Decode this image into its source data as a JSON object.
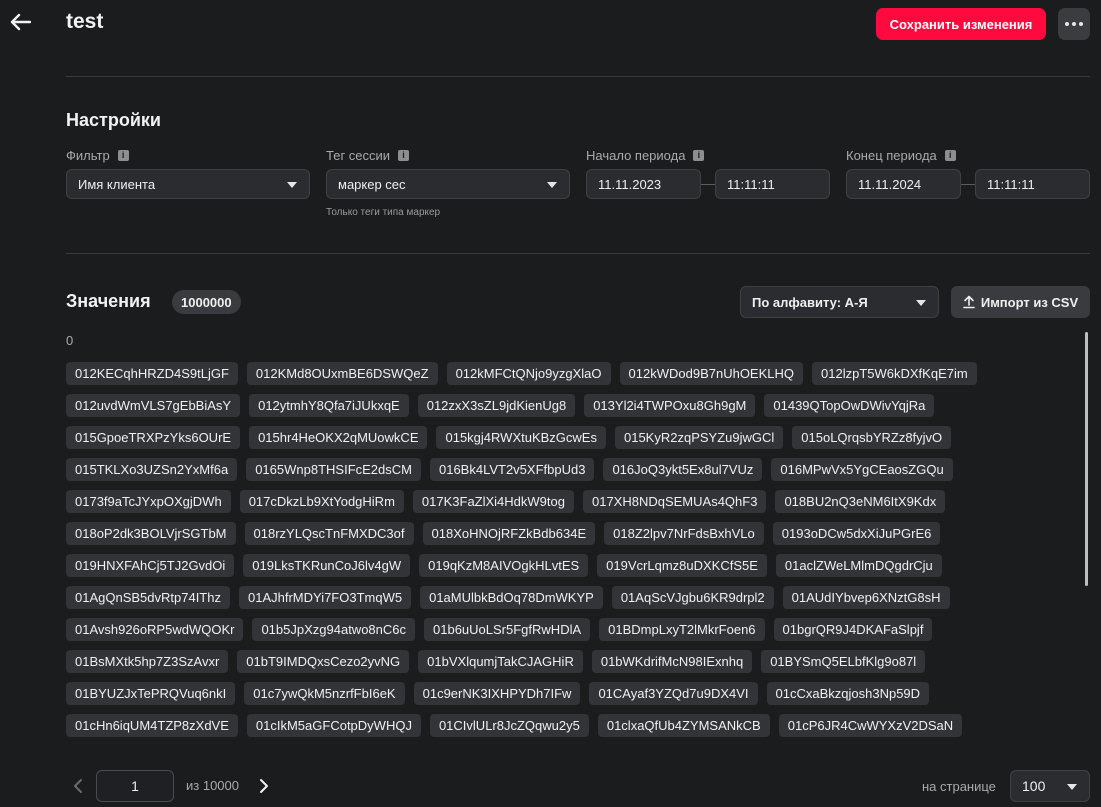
{
  "header": {
    "title": "test",
    "save_label": "Сохранить изменения"
  },
  "settings": {
    "title": "Настройки",
    "filter": {
      "label": "Фильтр",
      "value": "Имя клиента"
    },
    "session_tag": {
      "label": "Тег сессии",
      "value": "маркер сес",
      "helper": "Только теги типа маркер"
    },
    "period_start": {
      "label": "Начало периода",
      "date": "11.11.2023",
      "time": "11:11:11"
    },
    "period_end": {
      "label": "Конец периода",
      "date": "11.11.2024",
      "time": "11:11:11"
    }
  },
  "values": {
    "title": "Значения",
    "count": "1000000",
    "sort_value": "По алфавиту: А-Я",
    "import_label": "Импорт из CSV",
    "empty_value": "0",
    "items": [
      "012KECqhHRZD4S9tLjGF",
      "012KMd8OUxmBE6DSWQeZ",
      "012kMFCtQNjo9yzgXlaO",
      "012kWDod9B7nUhOEKLHQ",
      "012lzpT5W6kDXfKqE7im",
      "012uvdWmVLS7gEbBiAsY",
      "012ytmhY8Qfa7iJUkxqE",
      "012zxX3sZL9jdKienUg8",
      "013Yl2i4TWPOxu8Gh9gM",
      "01439QTopOwDWivYqjRa",
      "015GpoeTRXPzYks6OUrE",
      "015hr4HeOKX2qMUowkCE",
      "015kgj4RWXtuKBzGcwEs",
      "015KyR2zqPSYZu9jwGCl",
      "015oLQrqsbYRZz8fyjvO",
      "015TKLXo3UZSn2YxMf6a",
      "0165Wnp8THSIFcE2dsCM",
      "016Bk4LVT2v5XFfbpUd3",
      "016JoQ3ykt5Ex8ul7VUz",
      "016MPwVx5YgCEaosZGQu",
      "0173f9aTcJYxpOXgjDWh",
      "017cDkzLb9XtYodgHiRm",
      "017K3FaZlXi4HdkW9tog",
      "017XH8NDqSEMUAs4QhF3",
      "018BU2nQ3eNM6ItX9Kdx",
      "018oP2dk3BOLVjrSGTbM",
      "018rzYLQscTnFMXDC3of",
      "018XoHNOjRFZkBdb634E",
      "018Z2lpv7NrFdsBxhVLo",
      "0193oDCw5dxXiJuPGrE6",
      "019HNXFAhCj5TJ2GvdOi",
      "019LksTKRunCoJ6lv4gW",
      "019qKzM8AIVOgkHLvtES",
      "019VcrLqmz8uDXKCfS5E",
      "01aclZWeLMlmDQgdrCju",
      "01AgQnSB5dvRtp74IThz",
      "01AJhfrMDYi7FO3TmqW5",
      "01aMUlbkBdOq78DmWKYP",
      "01AqScVJgbu6KR9drpl2",
      "01AUdIYbvep6XNztG8sH",
      "01Avsh926oRP5wdWQOKr",
      "01b5JpXzg94atwo8nC6c",
      "01b6uUoLSr5FgfRwHDlA",
      "01BDmpLxyT2lMkrFoen6",
      "01bgrQR9J4DKAFaSlpjf",
      "01BsMXtk5hp7Z3SzAvxr",
      "01bT9IMDQxsCezo2yvNG",
      "01bVXlqumjTakCJAGHiR",
      "01bWKdrifMcN98IExnhq",
      "01BYSmQ5ELbfKlg9o87l",
      "01BYUZJxTePRQVuq6nkI",
      "01c7ywQkM5nzrfFbI6eK",
      "01c9erNK3IXHPYDh7IFw",
      "01CAyaf3YZQd7u9DX4VI",
      "01cCxaBkzqjosh3Np59D",
      "01cHn6iqUM4TZP8zXdVE",
      "01cIkM5aGFCotpDyWHQJ",
      "01CIvlULr8JcZQqwu2y5",
      "01clxaQfUb4ZYMSANkCB",
      "01cP6JR4CwWYXzV2DSaN"
    ]
  },
  "pagination": {
    "current_page": "1",
    "total_text": "из 10000",
    "per_page_label": "на странице",
    "per_page_value": "100"
  }
}
